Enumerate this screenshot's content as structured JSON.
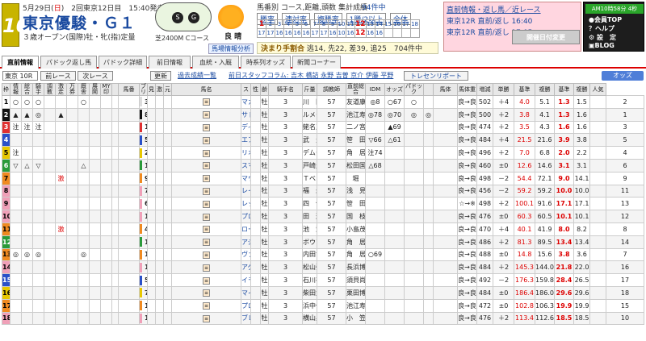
{
  "race": {
    "num": "10",
    "date_prefix": "5月29日(",
    "date_sun": "日",
    "date_suffix": ")　2回東京12日目　15:40発走",
    "title": "東京優駿・Ｇ１",
    "cond": "３歳オープン(国際)牡・牝(指)定量",
    "course": "芝2400M Cコース",
    "weather": "良 晴"
  },
  "header_links": {
    "l1": "馬番別 コース,距離,頭数 集計成績",
    "l2": "94件中",
    "b1": "勝率",
    "b2": "連対率",
    "b3": "複勝率",
    "b4": "1勝/2以上",
    "b5": "全体",
    "fav": "馬場情報分析"
  },
  "calendar": {
    "row1": [
      "1",
      "2",
      "3",
      "4",
      "5",
      "6",
      "7",
      "8",
      "9",
      "10",
      "11",
      "12",
      "13",
      "14",
      "15",
      "16",
      "17",
      "18"
    ],
    "row2": [
      "17",
      "17",
      "16",
      "16",
      "16",
      "16",
      "17",
      "17",
      "16",
      "10",
      "16",
      "12",
      "16",
      "16",
      "",
      "",
      "",
      ""
    ]
  },
  "kettei": {
    "label": "決まり手割合",
    "text": "逃14, 先22, 差39, 追25　704件中"
  },
  "right1": {
    "title": "直前情報・返し馬／近レース",
    "l1": "東京12R 直前/返し 16:40",
    "l2": "東京12R 直前/返し 17:05",
    "btn": "開催日付変更"
  },
  "right2": {
    "clock": "AM10時58分 4秒",
    "m1": "●会員TOP",
    "m2": "？ヘルプ",
    "m3": "⚙ 設　定",
    "m4": "▣BLOG"
  },
  "tabs": [
    "直前情報",
    "パドック返し馬",
    "パドック詳細",
    "前日情報",
    "血統・入厩",
    "時系列オッズ",
    "新聞コーナー"
  ],
  "toolbar": {
    "race": "東京 10R",
    "prev": "前レース",
    "next": "次レース",
    "refresh": "更新",
    "past": "過去成績一覧",
    "staff": "前日スタッフコラム: 吉木 橋詰 永野 吉曽 京介 伊藤 平野",
    "trend": "トレセンリポート",
    "odds": "オッズ"
  },
  "columns": [
    "枠",
    "情報",
    "総合",
    "騎手",
    "調教",
    "激走",
    "万券",
    "厩舎",
    "展開",
    "MY印",
    "",
    "馬番",
    "ブリ",
    "見",
    "激",
    "元",
    "馬名",
    "ス",
    "性",
    "齢",
    "騎手名",
    "斤量",
    "調教師",
    "直前総合",
    "IDM",
    "オッズ",
    "パドック",
    "",
    "馬体",
    "馬体重",
    "増減",
    "単勝",
    "基準",
    "複勝",
    "基準",
    "複勝",
    "人気"
  ],
  "horses": [
    {
      "g": "1",
      "gc": "#ffffff",
      "gt": "#000",
      "m": [
        "○",
        "○",
        "○",
        "",
        "",
        "",
        "○",
        "",
        "",
        ""
      ],
      "n": "3",
      "name": "マカヒキ",
      "s": "牡",
      "a": "3",
      "jk": "川　田",
      "w": "57",
      "tr": "友道康",
      "c": "◎8",
      "idm": "○67",
      "od": "○",
      "pd": "",
      "bd": "良→良",
      "bw": "502",
      "inc": "＋4",
      "win": "4.0",
      "b": "5.1",
      "pl": "1.3",
      "pb": "1.5",
      "pop": "2"
    },
    {
      "g": "2",
      "gc": "#111111",
      "gt": "#fff",
      "m": [
        "▲",
        "▲",
        "◎",
        "",
        "▲",
        "",
        "",
        "",
        "",
        ""
      ],
      "n": "8",
      "name": "サトノダイヤモンド",
      "s": "牡",
      "a": "3",
      "jk": "ルメー",
      "w": "57",
      "tr": "池江寿",
      "c": "◎78",
      "idm": "◎70",
      "od": "◎",
      "pd": "◎",
      "bd": "良→良",
      "bw": "500",
      "inc": "＋2",
      "win": "3.8",
      "b": "4.1",
      "pl": "1.3",
      "pb": "1.6",
      "pop": "1"
    },
    {
      "g": "3",
      "gc": "#e03030",
      "gt": "#fff",
      "m": [
        "注",
        "注",
        "注",
        "",
        "",
        "",
        "",
        "",
        "",
        ""
      ],
      "n": "1",
      "name": "ディーマジェスティ",
      "s": "牡",
      "a": "3",
      "jk": "蛯名正",
      "w": "57",
      "tr": "二ノ宮",
      "c": "",
      "idm": "▲69",
      "od": "",
      "pd": "",
      "bd": "良→良",
      "bw": "474",
      "inc": "＋2",
      "win": "3.5",
      "b": "4.3",
      "pl": "1.6",
      "pb": "1.6",
      "pop": "3"
    },
    {
      "g": "4",
      "gc": "#2a50c8",
      "gt": "#fff",
      "m": [
        "",
        "",
        "",
        "",
        "",
        "",
        "",
        "",
        "",
        ""
      ],
      "n": "5",
      "name": "エアスピネル",
      "s": "牡",
      "a": "3",
      "jk": "武　豊",
      "w": "57",
      "tr": "笹　田",
      "c": "▽66",
      "idm": "△61",
      "od": "",
      "pd": "",
      "bd": "良→良",
      "bw": "484",
      "inc": "＋4",
      "win": "21.5",
      "b": "21.6",
      "pl": "3.9",
      "pb": "3.8",
      "pop": "5"
    },
    {
      "g": "5",
      "gc": "#e8c800",
      "gt": "#000",
      "m": [
        "注",
        "",
        "",
        "",
        "",
        "",
        "",
        "",
        "",
        ""
      ],
      "n": "2",
      "name": "リオンディーズ",
      "s": "牡",
      "a": "3",
      "jk": "デムー",
      "w": "57",
      "tr": "角　居",
      "c": "注74",
      "idm": "",
      "od": "",
      "pd": "",
      "bd": "良→良",
      "bw": "496",
      "inc": "＋2",
      "win": "7.0",
      "b": "6.8",
      "pl": "2.0",
      "pb": "2.2",
      "pop": "4"
    },
    {
      "g": "6",
      "gc": "#2a9a3a",
      "gt": "#fff",
      "m": [
        "▽",
        "△",
        "▽",
        "",
        "",
        "",
        "△",
        "",
        "",
        ""
      ],
      "n": "10",
      "name": "スマートオーディン",
      "s": "牡",
      "a": "3",
      "jk": "戸崎圭",
      "w": "57",
      "tr": "松田国",
      "c": "△68",
      "idm": "",
      "od": "",
      "pd": "",
      "bd": "良→良",
      "bw": "460",
      "inc": "±0",
      "win": "12.6",
      "b": "14.6",
      "pl": "3.1",
      "pb": "3.1",
      "pop": "6"
    },
    {
      "g": "7",
      "gc": "#f08a20",
      "gt": "#000",
      "m": [
        "",
        "",
        "",
        "",
        "激",
        "",
        "",
        "",
        "",
        ""
      ],
      "n": "9",
      "name": "マウントロブソン",
      "s": "牡",
      "a": "3",
      "jk": "Ｔベリ",
      "w": "57",
      "tr": "堀",
      "c": "",
      "idm": "",
      "od": "",
      "pd": "",
      "bd": "良→良",
      "bw": "498",
      "inc": "－2",
      "win": "54.4",
      "b": "72.1",
      "pl": "9.0",
      "pb": "14.1",
      "pop": "9"
    },
    {
      "g": "8",
      "gc": "#f0a0b8",
      "gt": "#000",
      "m": [
        "",
        "",
        "",
        "",
        "",
        "",
        "",
        "",
        "",
        ""
      ],
      "n": "7",
      "name": "レインボーライン",
      "s": "牡",
      "a": "3",
      "jk": "福　永",
      "w": "57",
      "tr": "浅　見",
      "c": "",
      "idm": "",
      "od": "",
      "pd": "",
      "bd": "良→良",
      "bw": "456",
      "inc": "－2",
      "win": "59.2",
      "b": "59.2",
      "pl": "10.0",
      "pb": "10.0",
      "pop": "11"
    },
    {
      "g": "9",
      "gc": "#f0a0b8",
      "gt": "#000",
      "m": [
        "",
        "",
        "",
        "",
        "",
        "",
        "",
        "",
        "",
        ""
      ],
      "n": "6",
      "name": "レッドエルディスト",
      "s": "牡",
      "a": "3",
      "jk": "四　位",
      "w": "57",
      "tr": "笹　田",
      "c": "",
      "idm": "",
      "od": "",
      "pd": "",
      "bd": "☆→※",
      "bw": "498",
      "inc": "＋2",
      "win": "100.1",
      "b": "91.6",
      "pl": "17.1",
      "pb": "17.1",
      "pop": "13"
    },
    {
      "g": "10",
      "gc": "#f0a0b8",
      "gt": "#000",
      "m": [
        "",
        "",
        "",
        "",
        "",
        "",
        "",
        "",
        "",
        ""
      ],
      "n": "18",
      "name": "プロディガルサン",
      "s": "牡",
      "a": "3",
      "jk": "田　辺",
      "w": "57",
      "tr": "国　枝",
      "c": "",
      "idm": "",
      "od": "",
      "pd": "",
      "bd": "良→良",
      "bw": "476",
      "inc": "±0",
      "win": "60.3",
      "b": "60.5",
      "pl": "10.1",
      "pb": "10.1",
      "pop": "12"
    },
    {
      "g": "11",
      "gc": "#f08a20",
      "gt": "#000",
      "m": [
        "",
        "",
        "",
        "",
        "激",
        "",
        "",
        "",
        "",
        ""
      ],
      "n": "4",
      "name": "ロードクエスト",
      "s": "牡",
      "a": "3",
      "jk": "池　添",
      "w": "57",
      "tr": "小島茂",
      "c": "",
      "idm": "",
      "od": "",
      "pd": "",
      "bd": "良→良",
      "bw": "470",
      "inc": "＋4",
      "win": "40.1",
      "b": "41.9",
      "pl": "8.0",
      "pb": "8.2",
      "pop": "8"
    },
    {
      "g": "12",
      "gc": "#2a9a3a",
      "gt": "#fff",
      "m": [
        "",
        "",
        "",
        "",
        "",
        "",
        "",
        "",
        "",
        ""
      ],
      "n": "11",
      "name": "アジュールローズ",
      "s": "牡",
      "a": "3",
      "jk": "ボウマ",
      "w": "57",
      "tr": "角　居",
      "c": "",
      "idm": "",
      "od": "",
      "pd": "",
      "bd": "良→良",
      "bw": "486",
      "inc": "＋2",
      "win": "81.3",
      "b": "89.5",
      "pl": "13.4",
      "pb": "13.4",
      "pop": "14"
    },
    {
      "g": "13",
      "gc": "#f08a20",
      "gt": "#000",
      "m": [
        "◎",
        "◎",
        "◎",
        "",
        "",
        "",
        "◎",
        "",
        "",
        ""
      ],
      "n": "13",
      "name": "ヴァンキッシュラン",
      "s": "牡",
      "a": "3",
      "jk": "内田博",
      "w": "57",
      "tr": "角　居",
      "c": "○69",
      "idm": "",
      "od": "",
      "pd": "",
      "bd": "良→良",
      "bw": "488",
      "inc": "±0",
      "win": "14.8",
      "b": "15.6",
      "pl": "3.8",
      "pb": "3.6",
      "pop": "7"
    },
    {
      "g": "14",
      "gc": "#f0a0b8",
      "gt": "#000",
      "m": [
        "",
        "",
        "",
        "",
        "",
        "",
        "",
        "",
        "",
        ""
      ],
      "n": "15",
      "name": "アグネスフォルテ",
      "s": "牡",
      "a": "3",
      "jk": "松山弘",
      "w": "57",
      "tr": "長浜博",
      "c": "",
      "idm": "",
      "od": "",
      "pd": "",
      "bd": "良→良",
      "bw": "484",
      "inc": "＋2",
      "win": "145.3",
      "b": "144.0",
      "pl": "21.8",
      "pb": "22.0",
      "pop": "16"
    },
    {
      "g": "15",
      "gc": "#2a50c8",
      "gt": "#fff",
      "m": [
        "",
        "",
        "",
        "",
        "",
        "",
        "",
        "",
        "",
        ""
      ],
      "n": "5",
      "name": "イモータル",
      "s": "牡",
      "a": "3",
      "jk": "石川裕",
      "w": "57",
      "tr": "須貝尚",
      "c": "",
      "idm": "",
      "od": "",
      "pd": "",
      "bd": "良→良",
      "bw": "492",
      "inc": "－2",
      "win": "176.3",
      "b": "159.8",
      "pl": "28.4",
      "pb": "26.5",
      "pop": "17"
    },
    {
      "g": "16",
      "gc": "#e8c800",
      "gt": "#000",
      "m": [
        "",
        "",
        "",
        "",
        "",
        "",
        "",
        "",
        "",
        ""
      ],
      "n": "7",
      "name": "マイネルハニー",
      "s": "牡",
      "a": "3",
      "jk": "柴田大",
      "w": "57",
      "tr": "栗田博",
      "c": "",
      "idm": "",
      "od": "",
      "pd": "",
      "bd": "良→良",
      "bw": "484",
      "inc": "±0",
      "win": "186.4",
      "b": "186.0",
      "pl": "29.6",
      "pb": "29.6",
      "pop": "18"
    },
    {
      "g": "17",
      "gc": "#f08a20",
      "gt": "#000",
      "m": [
        "",
        "",
        "",
        "",
        "",
        "",
        "",
        "",
        "",
        ""
      ],
      "n": "12",
      "name": "プロフェット",
      "s": "牡",
      "a": "3",
      "jk": "浜中俊",
      "w": "57",
      "tr": "池江寿",
      "c": "",
      "idm": "",
      "od": "",
      "pd": "",
      "bd": "良→良",
      "bw": "472",
      "inc": "±0",
      "win": "102.8",
      "b": "106.3",
      "pl": "19.9",
      "pb": "19.9",
      "pop": "15"
    },
    {
      "g": "18",
      "gc": "#f0a0b8",
      "gt": "#000",
      "m": [
        "",
        "",
        "",
        "",
        "",
        "",
        "",
        "",
        "",
        ""
      ],
      "n": "16",
      "name": "ブレイブスマッシュ",
      "s": "牡",
      "a": "3",
      "jk": "横山典",
      "w": "57",
      "tr": "小　笠",
      "c": "",
      "idm": "",
      "od": "",
      "pd": "",
      "bd": "良→良",
      "bw": "476",
      "inc": "＋2",
      "win": "113.4",
      "b": "112.6",
      "pl": "18.5",
      "pb": "18.5",
      "pop": "10"
    }
  ]
}
